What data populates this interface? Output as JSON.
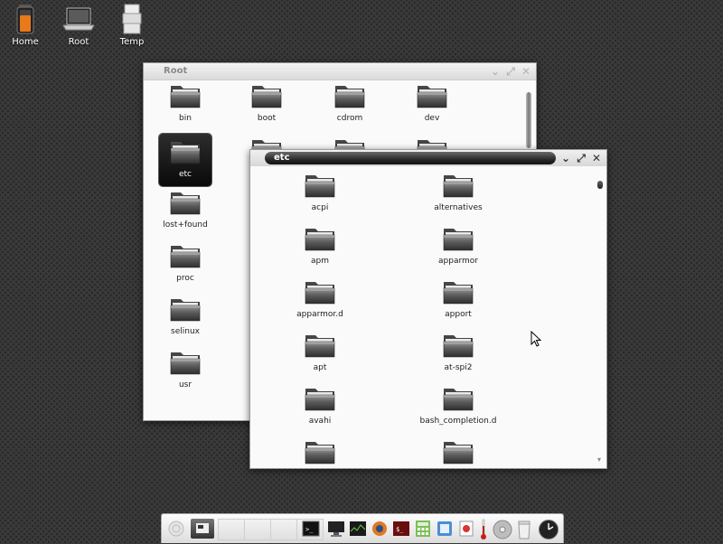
{
  "desktop": {
    "icons": [
      {
        "label": "Home",
        "icon": "battery-trash-icon"
      },
      {
        "label": "Root",
        "icon": "laptop-icon"
      },
      {
        "label": "Temp",
        "icon": "boxes-icon"
      }
    ]
  },
  "root_window": {
    "title": "Root",
    "folders": [
      "bin",
      "boot",
      "cdrom",
      "dev",
      "etc",
      "lost+found",
      "proc",
      "selinux",
      "usr"
    ],
    "selected": "etc"
  },
  "etc_window": {
    "title": "etc",
    "folders": [
      "acpi",
      "alternatives",
      "apm",
      "apparmor",
      "apparmor.d",
      "apport",
      "apt",
      "at-spi2",
      "avahi",
      "bash_completion.d"
    ]
  },
  "taskbar": {
    "launchers": [
      "terminal-icon",
      "monitor-icon",
      "system-monitor-icon",
      "firefox-icon",
      "terminal-red-icon",
      "calculator-icon",
      "finder-icon",
      "paint-icon",
      "thermometer-icon",
      "disk-icon",
      "trash-icon",
      "clock-icon"
    ]
  },
  "colors": {
    "selected_folder": "#0a0a0a",
    "window_bg": "#fafafa",
    "desktop_bg": "#3b3b3b"
  }
}
